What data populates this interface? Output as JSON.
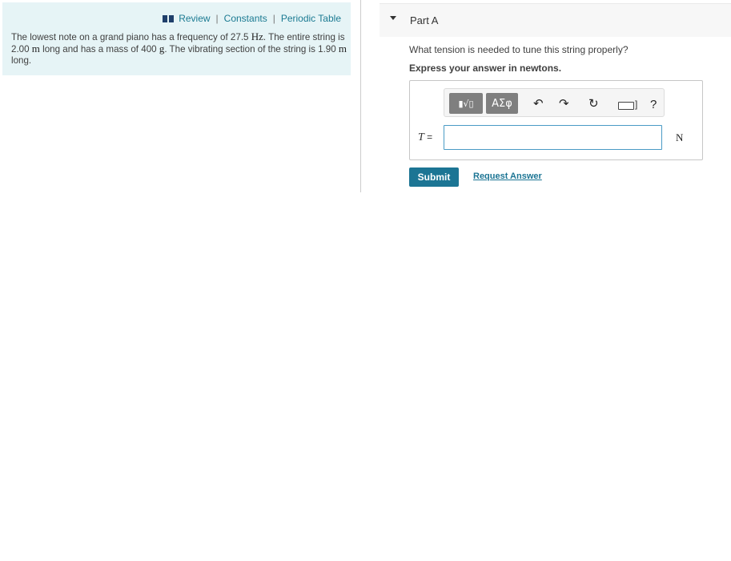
{
  "left_panel": {
    "links": {
      "review": "Review",
      "constants": "Constants",
      "periodic_table": "Periodic Table",
      "separator": "|"
    },
    "problem": {
      "t1": "The lowest note on a grand piano has a frequency of 27.5 ",
      "u1": "Hz",
      "t2": ". The entire string is 2.00 ",
      "u2": "m",
      "t3": " long and has a mass of 400 ",
      "u3": "g",
      "t4": ". The vibrating section of the string is 1.90 ",
      "u4": "m",
      "t5": " long."
    }
  },
  "part": {
    "title": "Part A",
    "question": "What tension is needed to tune this string properly?",
    "instruction": "Express your answer in newtons.",
    "toolbar": {
      "template_button": "▮√▯",
      "greek_button": "ΑΣφ",
      "undo_icon": "↶",
      "redo_icon": "↷",
      "reset_icon": "↻",
      "keyboard_bracket": "]",
      "help_icon": "?"
    },
    "variable": "T",
    "equals": " =",
    "input_value": "",
    "unit": "N",
    "submit_label": "Submit",
    "request_answer_label": "Request Answer"
  },
  "colors": {
    "accent": "#1c7594",
    "panel_bg": "#e6f4f6",
    "input_border": "#4a9bc5"
  }
}
